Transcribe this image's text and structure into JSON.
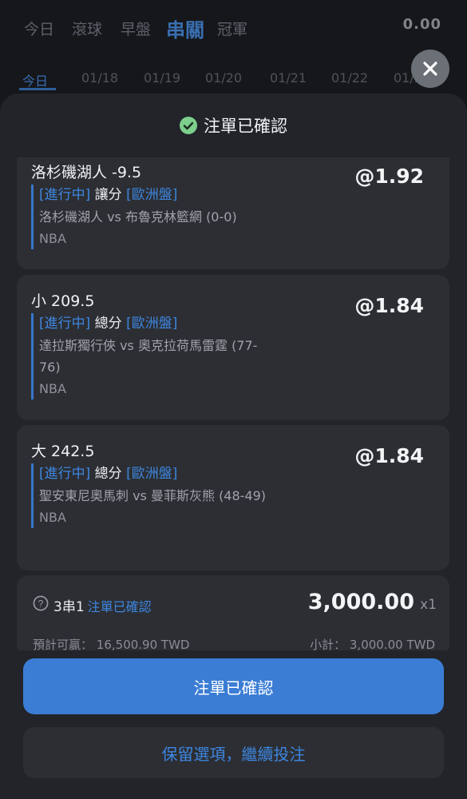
{
  "nav": {
    "tabs": [
      "今日",
      "滾球",
      "早盤",
      "串關",
      "冠軍"
    ],
    "active_tab": "串關",
    "balance": "0.00"
  },
  "dates": [
    "今日",
    "01/18",
    "01/19",
    "01/20",
    "01/21",
    "01/22",
    "01/23"
  ],
  "sheet": {
    "title": "注單已確認",
    "selections": [
      {
        "title": "洛杉磯湖人 -9.5",
        "odds": "@1.92",
        "status": "[進行中]",
        "market": "讓分",
        "odds_type": "[歐洲盤]",
        "teams": "洛杉磯湖人 vs 布魯克林籃網 (0-0)",
        "league": "NBA"
      },
      {
        "title": "小 209.5",
        "odds": "@1.84",
        "status": "[進行中]",
        "market": "總分",
        "odds_type": "[歐洲盤]",
        "teams": "達拉斯獨行俠 vs 奧克拉荷馬雷霆 (77-76)",
        "league": "NBA"
      },
      {
        "title": "大 242.5",
        "odds": "@1.84",
        "status": "[進行中]",
        "market": "總分",
        "odds_type": "[歐洲盤]",
        "teams": "聖安東尼奧馬刺 vs 曼菲斯灰熊 (48-49)",
        "league": "NBA"
      }
    ],
    "summary": {
      "parlay": "3串1",
      "status": "注單已確認",
      "stake": "3,000.00",
      "multiplier": "x1",
      "est_win_label": "預計可贏：",
      "est_win_value": "16,500.90 TWD",
      "subtotal_label": "小計：",
      "subtotal_value": "3,000.00 TWD"
    },
    "primary_button": "注單已確認",
    "secondary_button": "保留選項，繼續投注"
  },
  "colors": {
    "accent": "#3b7dd4",
    "link_blue": "#3d86e0",
    "check_green": "#7ccf8c"
  }
}
